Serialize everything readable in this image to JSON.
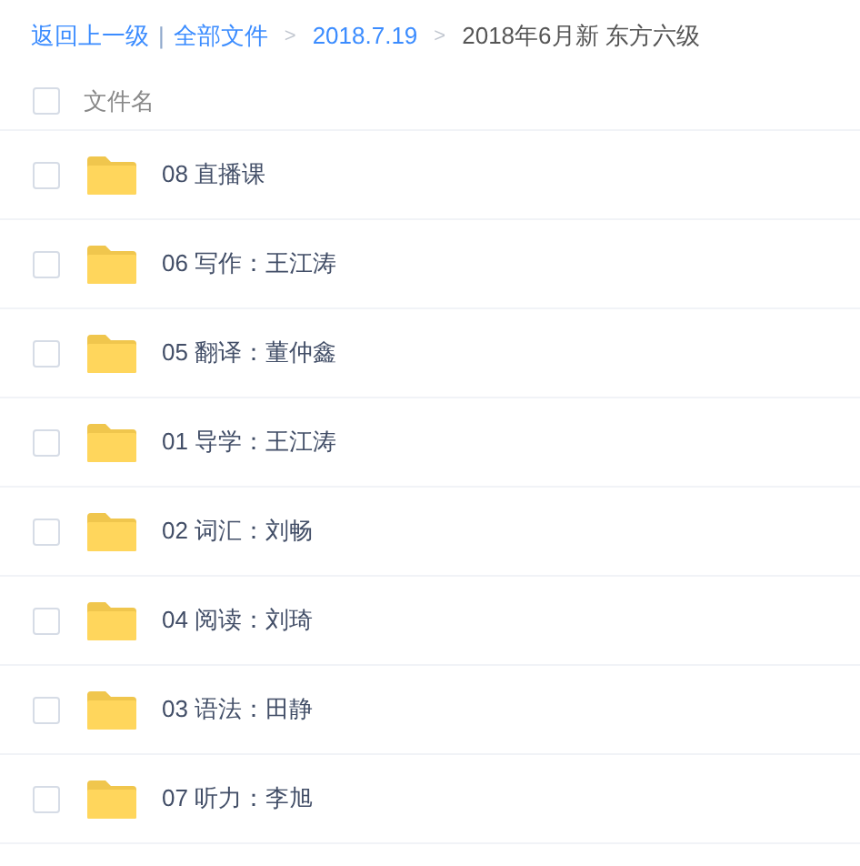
{
  "breadcrumb": {
    "back": "返回上一级",
    "divider": "|",
    "links": [
      "全部文件",
      "2018.7.19"
    ],
    "separator": ">",
    "current": "2018年6月新 东方六级"
  },
  "header": {
    "checked": false,
    "column": "文件名"
  },
  "rows": [
    {
      "name": "08 直播课",
      "checked": false
    },
    {
      "name": "06 写作：王江涛",
      "checked": false
    },
    {
      "name": "05 翻译：董仲鑫",
      "checked": false
    },
    {
      "name": "01 导学：王江涛",
      "checked": false
    },
    {
      "name": "02 词汇：刘畅",
      "checked": false
    },
    {
      "name": "04 阅读：刘琦",
      "checked": false
    },
    {
      "name": "03 语法：田静",
      "checked": false
    },
    {
      "name": "07 听力：李旭",
      "checked": false
    }
  ]
}
